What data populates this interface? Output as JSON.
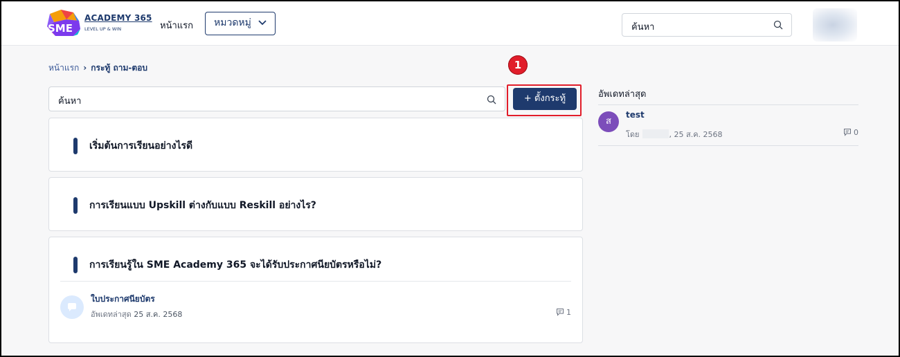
{
  "header": {
    "logo_mark": "SME",
    "logo_title": "ACADEMY 365",
    "logo_tagline": "LEVEL UP & WIN",
    "nav_home": "หน้าแรก",
    "category_label": "หมวดหมู่",
    "search_placeholder": "ค้นหา"
  },
  "breadcrumb": {
    "home": "หน้าแรก",
    "separator": "›",
    "current": "กระทู้ ถาม-ตอบ"
  },
  "main": {
    "search_placeholder": "ค้นหา",
    "new_topic_label": "+ ตั้งกระทู้",
    "step_badge": "1",
    "topics": [
      {
        "title": "เริ่มต้นการเรียนอย่างไรดี"
      },
      {
        "title": "การเรียนแบบ Upskill ต่างกับแบบ Reskill อย่างไร?"
      },
      {
        "title": "การเรียนรู้ใน SME Academy 365 จะได้รับประกาศนียบัตรหรือไม่?",
        "sub_item": {
          "title": "ใบประกาศนียบัตร",
          "meta_prefix": "อัพเดทล่าสุด",
          "date": "25 ส.ค. 2568",
          "count": "1"
        }
      }
    ]
  },
  "sidebar": {
    "heading": "อัพเดทล่าสุด",
    "latest": {
      "avatar_letter": "ส",
      "title": "test",
      "by_prefix": "โดย",
      "date": ", 25 ส.ค. 2568",
      "count": "0"
    }
  },
  "colors": {
    "primary": "#1e3a6d",
    "highlight": "#e11d2a",
    "avatar": "#7c4dba"
  },
  "icons": [
    "search-icon",
    "chevron-down-icon",
    "comment-icon",
    "chat-bubble-icon"
  ]
}
